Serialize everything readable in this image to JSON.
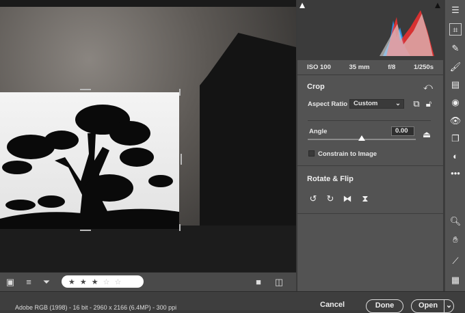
{
  "exif": {
    "iso": "ISO 100",
    "focal": "35 mm",
    "aperture": "f/8",
    "shutter": "1/250s"
  },
  "crop": {
    "title": "Crop",
    "aspect_label": "Aspect Ratio",
    "aspect_value": "Custom",
    "angle_label": "Angle",
    "angle_value": "0.00",
    "angle_slider_fraction": 0.5,
    "constrain_label": "Constrain to Image",
    "constrain_checked": false
  },
  "rotate": {
    "title": "Rotate & Flip"
  },
  "filmstrip": {
    "rating": 3,
    "max_rating": 5
  },
  "status": {
    "info": "Adobe RGB (1998) - 16 bit - 2960 x 2166 (6.4MP) - 300 ppi"
  },
  "buttons": {
    "cancel": "Cancel",
    "done": "Done",
    "open": "Open"
  },
  "icons": {
    "stars_on": "★",
    "stars_off": "☆"
  }
}
